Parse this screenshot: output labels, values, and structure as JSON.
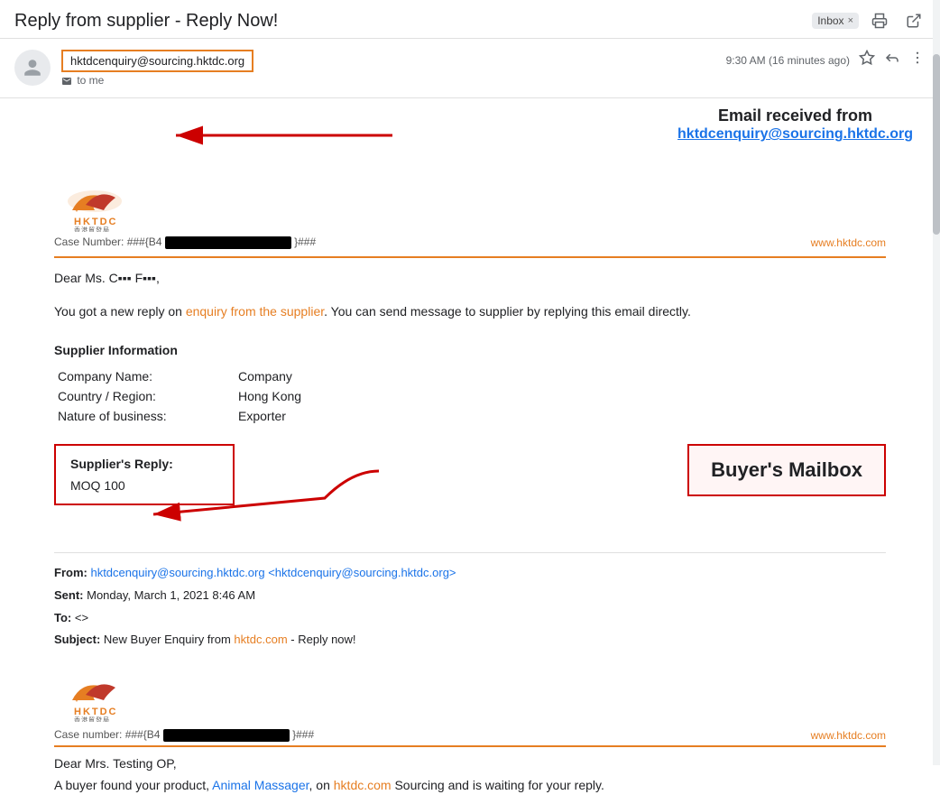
{
  "topBar": {
    "subject": "Reply from supplier - Reply Now!",
    "badge": "Inbox",
    "badgeClose": "×",
    "printIcon": "🖨",
    "openIcon": "↗"
  },
  "emailHeader": {
    "senderEmail": "hktdcenquiry@sourcing.hktdc.org",
    "toLabel": "to me",
    "time": "9:30 AM (16 minutes ago)",
    "starIcon": "☆",
    "replyIcon": "↩",
    "moreIcon": "⋮"
  },
  "annotation": {
    "title": "Email received from",
    "link": "hktdcenquiry@sourcing.hktdc.org"
  },
  "emailBody": {
    "websiteUrl": "www.hktdc.com",
    "caseNumber": "Case Number: ###{B4",
    "caseNumberEnd": "}###",
    "dearLine": "Dear Ms. C▪▪▪ F▪▪▪,",
    "message": "You got a new reply on enquiry from the supplier. You can send message to supplier by replying this email directly.",
    "messageHighlight1": "new reply on enquiry from the supplier",
    "supplierInfoTitle": "Supplier Information",
    "supplierFields": [
      {
        "label": "Company Name:",
        "value": "Company"
      },
      {
        "label": "Country / Region:",
        "value": "Hong Kong"
      },
      {
        "label": "Nature of business:",
        "value": "Exporter"
      }
    ],
    "supplierReplyLabel": "Supplier's Reply:",
    "supplierReplyContent": "MOQ 100",
    "buyersMailboxText": "Buyer's Mailbox"
  },
  "footer": {
    "fromLabel": "From:",
    "fromEmail": "hktdcenquiry@sourcing.hktdc.org",
    "fromEmailAngle": "hktdcenquiry@sourcing.hktdc.org",
    "sentLabel": "Sent:",
    "sentValue": "Monday, March 1, 2021 8:46 AM",
    "toLabel": "To:",
    "toValue": "<>",
    "subjectLabel": "Subject:",
    "subjectPre": "New Buyer Enquiry from ",
    "subjectLink": "hktdc.com",
    "subjectPost": " - Reply now!",
    "websiteUrl": "www.hktdc.com",
    "caseNumber": "Case number: ###{B4",
    "caseNumberEnd": "}###",
    "dearLine": "Dear Mrs. Testing OP,",
    "bodyText": "A buyer found your product, Animal Massager, on hktdc.com Sourcing and is waiting for your reply."
  }
}
